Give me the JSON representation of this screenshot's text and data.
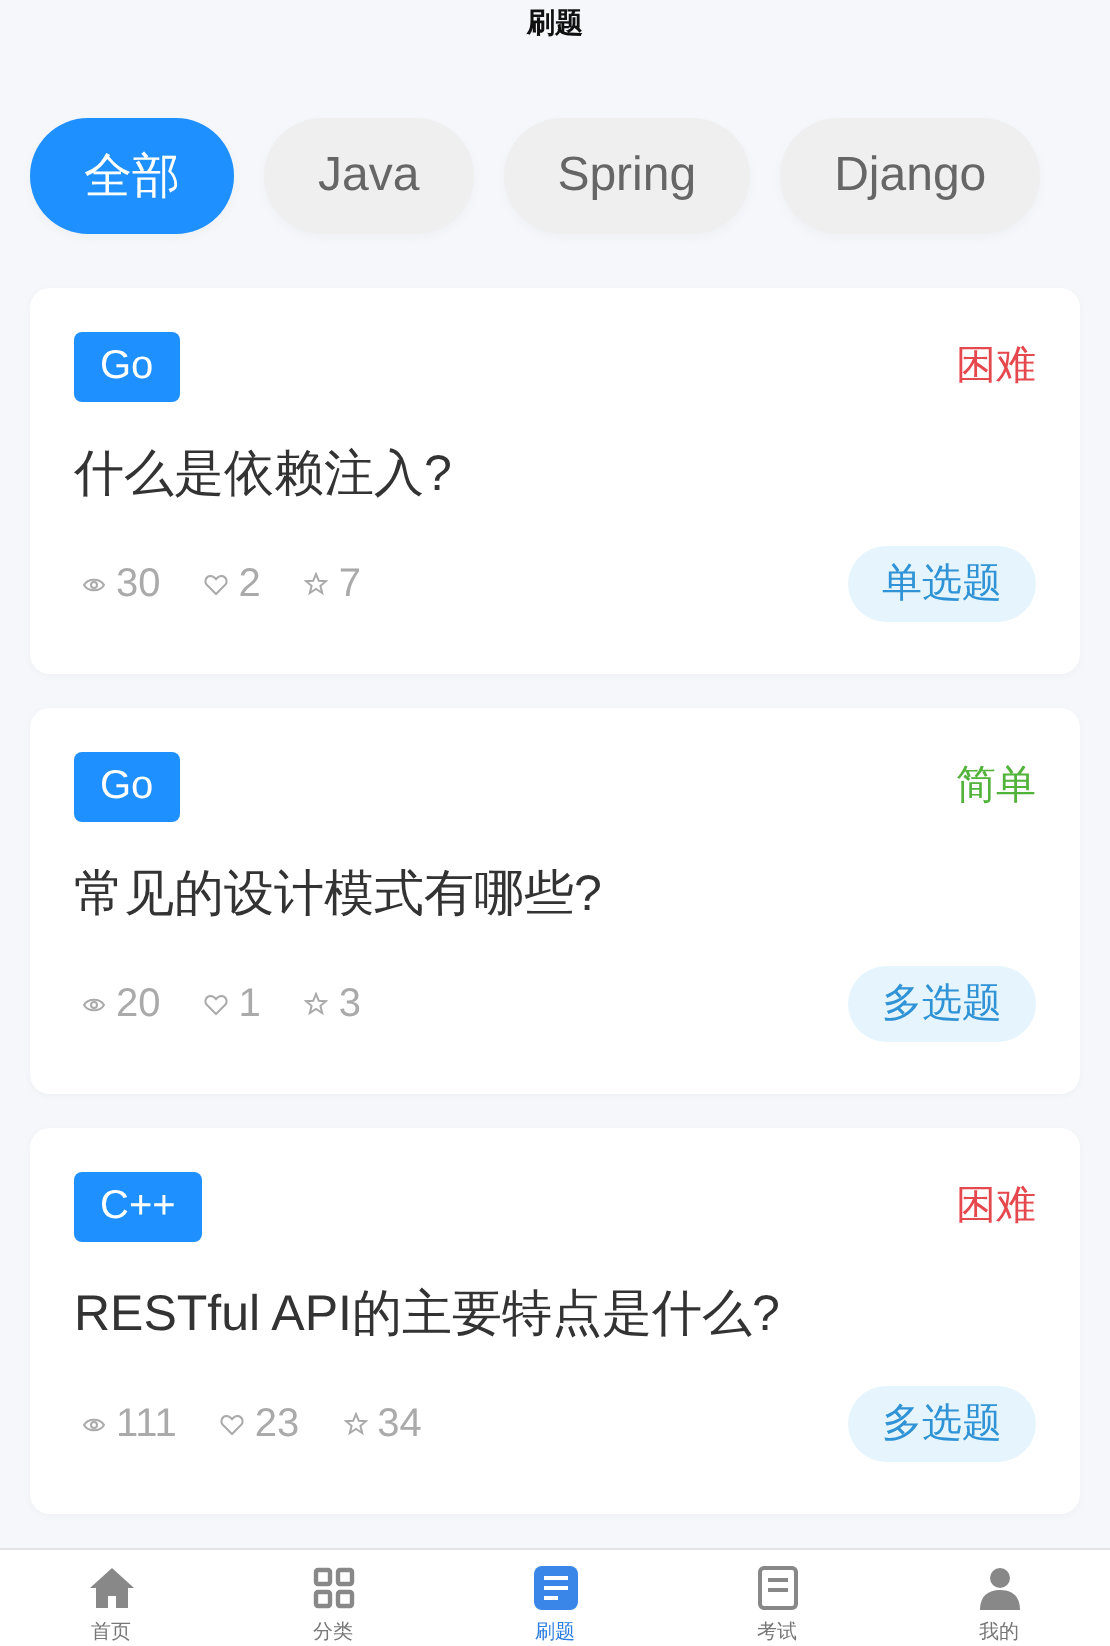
{
  "header": {
    "title": "刷题"
  },
  "categories": [
    {
      "label": "全部",
      "selected": true
    },
    {
      "label": "Java",
      "selected": false
    },
    {
      "label": "Spring",
      "selected": false
    },
    {
      "label": "Django",
      "selected": false
    }
  ],
  "questions": [
    {
      "tag": "Go",
      "difficulty": {
        "label": "困难",
        "color": "#e5484d"
      },
      "title": "什么是依赖注入?",
      "views": "30",
      "likes": "2",
      "favorites": "7",
      "type": "单选题"
    },
    {
      "tag": "Go",
      "difficulty": {
        "label": "简单",
        "color": "#52b33a"
      },
      "title": "常见的设计模式有哪些?",
      "views": "20",
      "likes": "1",
      "favorites": "3",
      "type": "多选题"
    },
    {
      "tag": "C++",
      "difficulty": {
        "label": "困难",
        "color": "#e5484d"
      },
      "title": "RESTful API的主要特点是什么?",
      "views": "111",
      "likes": "23",
      "favorites": "34",
      "type": "多选题"
    }
  ],
  "tab_bar": [
    {
      "label": "首页",
      "selected": false
    },
    {
      "label": "分类",
      "selected": false
    },
    {
      "label": "刷题",
      "selected": true
    },
    {
      "label": "考试",
      "selected": false
    },
    {
      "label": "我的",
      "selected": false
    }
  ]
}
